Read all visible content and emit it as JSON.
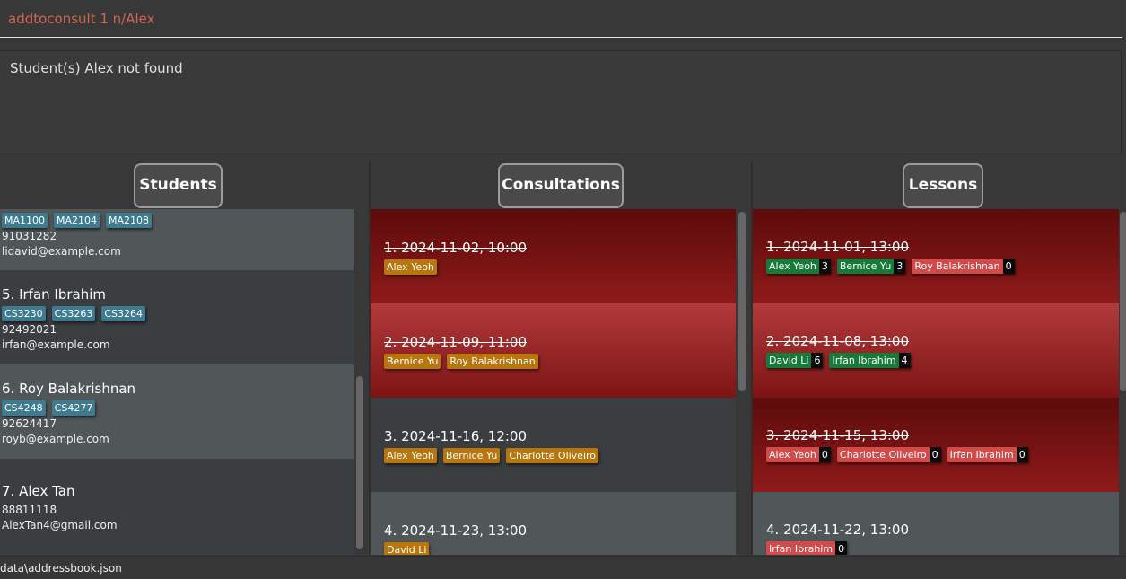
{
  "command": {
    "value": "addtoconsult 1 n/Alex"
  },
  "result": {
    "text": "Student(s) Alex not found"
  },
  "students": {
    "header": "Students",
    "partial_card": {
      "tags": [
        "MA1100",
        "MA2104",
        "MA2108"
      ],
      "phone": "91031282",
      "email": "lidavid@example.com"
    },
    "cards": [
      {
        "title": "5. Irfan Ibrahim",
        "tags": [
          "CS3230",
          "CS3263",
          "CS3264"
        ],
        "phone": "92492021",
        "email": "irfan@example.com"
      },
      {
        "title": "6. Roy Balakrishnan",
        "tags": [
          "CS4248",
          "CS4277"
        ],
        "phone": "92624417",
        "email": "royb@example.com"
      },
      {
        "title": "7. Alex Tan",
        "tags": [],
        "phone": "88811118",
        "email": "AlexTan4@gmail.com"
      }
    ]
  },
  "consultations": {
    "header": "Consultations",
    "cards": [
      {
        "title": "1. 2024-11-02, 10:00",
        "students": [
          "Alex Yeoh"
        ]
      },
      {
        "title": "2. 2024-11-09, 11:00",
        "students": [
          "Bernice Yu",
          "Roy Balakrishnan"
        ]
      },
      {
        "title": "3. 2024-11-16, 12:00",
        "students": [
          "Alex Yeoh",
          "Bernice Yu",
          "Charlotte Oliveiro"
        ]
      },
      {
        "title": "4. 2024-11-23, 13:00",
        "students": [
          "David Li"
        ]
      }
    ]
  },
  "lessons": {
    "header": "Lessons",
    "cards": [
      {
        "title": "1. 2024-11-01, 13:00",
        "students": [
          {
            "name": "Alex Yeoh",
            "count": "3"
          },
          {
            "name": "Bernice Yu",
            "count": "3"
          },
          {
            "name": "Roy Balakrishnan",
            "count": "0"
          }
        ]
      },
      {
        "title": "2. 2024-11-08, 13:00",
        "students": [
          {
            "name": "David Li",
            "count": "6"
          },
          {
            "name": "Irfan Ibrahim",
            "count": "4"
          }
        ]
      },
      {
        "title": "3. 2024-11-15, 13:00",
        "students": [
          {
            "name": "Alex Yeoh",
            "count": "0"
          },
          {
            "name": "Charlotte Oliveiro",
            "count": "0"
          },
          {
            "name": "Irfan Ibrahim",
            "count": "0"
          }
        ]
      },
      {
        "title": "4. 2024-11-22, 13:00",
        "students": [
          {
            "name": "Irfan Ibrahim",
            "count": "0"
          }
        ]
      }
    ]
  },
  "status_bar": {
    "path": "data\\addressbook.json"
  },
  "colors": {
    "command_text": "#d06651",
    "tag_module": "#3e7b91",
    "tag_consult_student": "#b8760d",
    "tag_attended": "#177a3a",
    "tag_absent": "#d24b4b",
    "past_card": "#8f1a1a"
  }
}
